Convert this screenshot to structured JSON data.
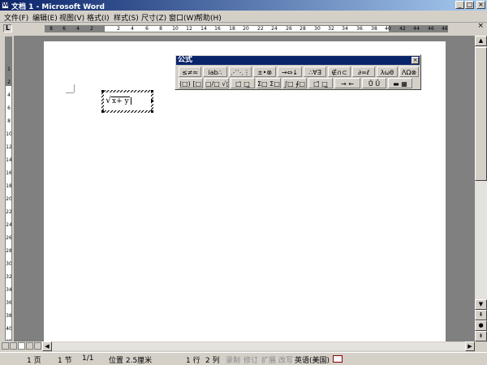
{
  "window": {
    "title": "文档 1 - Microsoft Word",
    "icon_letter": "W",
    "minimize_glyph": "_",
    "maximize_glyph": "□",
    "close_glyph": "×"
  },
  "menu": {
    "items": [
      "文件(F)",
      "编辑(E)",
      "视图(V)",
      "格式(I)",
      "样式(S)",
      "尺寸(Z)",
      "窗口(W)",
      "帮助(H)"
    ],
    "doc_close": "×"
  },
  "ruler": {
    "corner_glyph": "L",
    "ticks": [
      "8",
      "6",
      "4",
      "2",
      "2",
      "4",
      "6",
      "8",
      "10",
      "12",
      "14",
      "16",
      "18",
      "20",
      "22",
      "24",
      "26",
      "28",
      "30",
      "32",
      "34",
      "36",
      "38",
      "40",
      "42",
      "44",
      "46",
      "48"
    ],
    "vticks": [
      "1",
      "2",
      "4",
      "6",
      "8",
      "10",
      "12",
      "14",
      "16",
      "18",
      "20",
      "22",
      "24",
      "26",
      "28",
      "30",
      "32",
      "34",
      "36",
      "38",
      "40",
      "42"
    ]
  },
  "equation": {
    "radical": "√",
    "text": "x+ y",
    "cursor_after": true
  },
  "equation_toolbar": {
    "title": "公式",
    "close_glyph": "×",
    "row1": [
      "≤≠≈",
      "ⅰab∴",
      "⋰⋱⋮",
      "±•⊗",
      "→⇔↓",
      "∴∀∃",
      "∉∩⊂",
      "∂∞ℓ",
      "λωθ",
      "ΛΩ⊗"
    ],
    "row2": [
      "(□) [□]",
      "□/□ √□",
      "□̇ □̲",
      "Σ□ Σ□",
      "∫□ ∮□",
      "□̄ □̲",
      "→ ←",
      "Ů Ǘ",
      "▬ ▦"
    ]
  },
  "statusbar": {
    "page": "1 页",
    "section": "1 节",
    "page_of": "1/1",
    "position": "位置 2.5厘米",
    "line": "1 行",
    "column": "2 列",
    "rec": "录制",
    "trk": "修订",
    "ext": "扩展",
    "ovr": "改写",
    "language": "英语(美国)"
  },
  "scrollbar": {
    "up": "▲",
    "down": "▼",
    "left": "◀",
    "right": "▶",
    "prev": "⇞",
    "select_browse": "●",
    "next": "⇟"
  }
}
